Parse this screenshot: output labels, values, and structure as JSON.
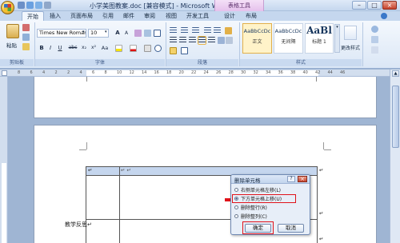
{
  "title_bar": {
    "title": "小学美图教案.doc [兼容模式] - Microsoft Word",
    "contextual_tab": "表格工具"
  },
  "tabs": [
    "开始",
    "插入",
    "页面布局",
    "引用",
    "邮件",
    "审阅",
    "视图",
    "开发工具",
    "设计",
    "布局"
  ],
  "ribbon": {
    "clipboard": {
      "paste_label": "粘贴",
      "group_label": "剪贴板"
    },
    "font": {
      "font_name": "Times New Romar",
      "font_size": "10",
      "bold": "B",
      "italic": "I",
      "underline": "U",
      "strikethrough": "abc",
      "subscript": "x₂",
      "superscript": "x²",
      "change_case": "Aa",
      "grow": "A",
      "shrink": "A",
      "group_label": "字体"
    },
    "paragraph": {
      "group_label": "段落"
    },
    "styles": {
      "cards": [
        {
          "sample": "AaBbCcDc",
          "name": "正文"
        },
        {
          "sample": "AaBbCcDc",
          "name": "无间隔"
        },
        {
          "sample": "AaBl",
          "name": "标题 1"
        }
      ],
      "change_styles": "更改样式",
      "group_label": "样式"
    }
  },
  "ruler_numbers": [
    "8",
    "6",
    "4",
    "2",
    "2",
    "4",
    "6",
    "8",
    "10",
    "12",
    "14",
    "16",
    "18",
    "20",
    "22",
    "24",
    "26",
    "28",
    "30",
    "32",
    "34",
    "36",
    "38",
    "40",
    "42",
    "44",
    "46"
  ],
  "document": {
    "row1_mark": "↵",
    "row1_cell_marks": "↵ ↵",
    "row1_end_mark": "↵",
    "teaching_reflection": "教学反思↵",
    "reflection_mark": "↵",
    "bottom_mark": "↵"
  },
  "dialog": {
    "title": "删除单元格",
    "help": "?",
    "close": "×",
    "options": [
      {
        "label": "右侧单元格左移(L)",
        "selected": false
      },
      {
        "label": "下方单元格上移(U)",
        "selected": true
      },
      {
        "label": "删除整行(R)",
        "selected": false
      },
      {
        "label": "删除整列(C)",
        "selected": false
      }
    ],
    "ok": "确定",
    "cancel": "取消"
  },
  "colors": {
    "highlight_annotation": "#e0121a",
    "table_header_fill": "#c5d6ee"
  }
}
